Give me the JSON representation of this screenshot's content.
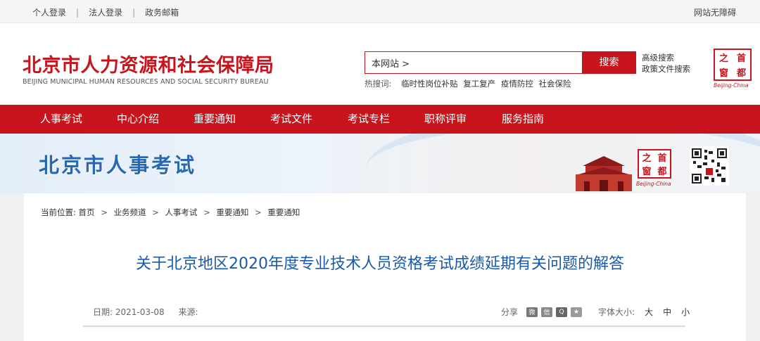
{
  "topbar": {
    "links": [
      "个人登录",
      "法人登录",
      "政务邮箱"
    ],
    "separator": "|",
    "accessibility": "网站无障碍"
  },
  "header": {
    "logo_cn": "北京市人力资源和社会保障局",
    "logo_en": "BEIJING MUNICIPAL HUMAN RESOURCES AND SOCIAL SECURITY BUREAU",
    "search_value": "本网站 >",
    "search_button": "搜索",
    "hot_label": "热搜词:",
    "hot_words": [
      "临时性岗位补贴",
      "复工复产",
      "疫情防控",
      "社会保险"
    ],
    "advanced_search": "高级搜索",
    "policy_search": "政策文件搜索",
    "emblem_chars": [
      "之",
      "首",
      "窗",
      "都"
    ],
    "emblem_caption": "Beijing-China"
  },
  "nav": {
    "items": [
      "人事考试",
      "中心介绍",
      "重要通知",
      "考试文件",
      "考试专栏",
      "职称评审",
      "服务指南"
    ]
  },
  "banner": {
    "title": "北京市人事考试",
    "emblem_chars": [
      "之",
      "首",
      "窗",
      "都"
    ],
    "emblem_caption": "Beijing-China"
  },
  "breadcrumb": {
    "label": "当前位置:",
    "items": [
      "首页",
      "业务频道",
      "人事考试",
      "重要通知",
      "重要通知"
    ],
    "separator": ">"
  },
  "article": {
    "title": "关于北京地区2020年度专业技术人员资格考试成绩延期有关问题的解答",
    "date_label": "日期:",
    "date": "2021-03-08",
    "source_label": "来源:",
    "share_label": "分享",
    "share_icons": [
      "weibo-icon",
      "wechat-icon",
      "qq-icon",
      "qzone-icon"
    ],
    "font_size_label": "字体大小:",
    "font_sizes": [
      "大",
      "中",
      "小"
    ]
  },
  "colors": {
    "brand_red": "#c8151d",
    "title_blue": "#1a5aa8",
    "banner_blue": "#2a67b1"
  }
}
